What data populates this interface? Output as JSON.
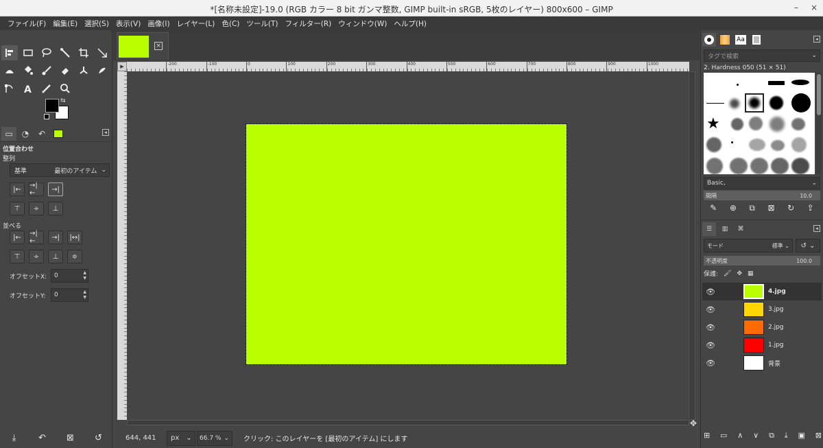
{
  "window": {
    "title": "*[名称未設定]-19.0 (RGB カラー 8 bit ガンマ整数, GIMP built-in sRGB, 5枚のレイヤー) 800x600 – GIMP",
    "minimize": "–",
    "close": "×"
  },
  "menu": [
    "ファイル(F)",
    "編集(E)",
    "選択(S)",
    "表示(V)",
    "画像(I)",
    "レイヤー(L)",
    "色(C)",
    "ツール(T)",
    "フィルター(R)",
    "ウィンドウ(W)",
    "ヘルプ(H)"
  ],
  "image_thumb_color": "#b9ff00",
  "canvas_color": "#b9ff00",
  "ruler": {
    "corner": "▶",
    "labels": [
      "-200",
      "-100",
      "0",
      "100",
      "200",
      "300",
      "400",
      "500",
      "600",
      "700",
      "800",
      "900",
      "1000"
    ]
  },
  "align_panel": {
    "title": "位置合わせ",
    "align_section": "整列",
    "relative_label": "基準",
    "relative_value": "最初のアイテム",
    "distribute_section": "並べる",
    "offset_x_label": "オフセットX:",
    "offset_x_value": "0",
    "offset_y_label": "オフセットY:",
    "offset_y_value": "0"
  },
  "status": {
    "coords": "644, 441",
    "unit": "px",
    "zoom": "66.7 %",
    "message": "クリック: このレイヤーを [最初のアイテム] にします"
  },
  "brushes": {
    "tag_placeholder": "タグで検索",
    "selected_brush": "2. Hardness 050 (51 × 51)",
    "brush_set": "Basic,",
    "spacing_label": "間隔",
    "spacing_value": "10.0"
  },
  "layers_panel": {
    "mode_label": "モード",
    "mode_value": "標準",
    "opacity_label": "不透明度",
    "opacity_value": "100.0",
    "lock_label": "保護:",
    "layers": [
      {
        "name": "4.jpg",
        "color": "#b9ff00",
        "selected": true
      },
      {
        "name": "3.jpg",
        "color": "#ffd700",
        "selected": false
      },
      {
        "name": "2.jpg",
        "color": "#ff6a00",
        "selected": false
      },
      {
        "name": "1.jpg",
        "color": "#ff0000",
        "selected": false
      },
      {
        "name": "背景",
        "color": "#ffffff",
        "selected": false
      }
    ]
  }
}
